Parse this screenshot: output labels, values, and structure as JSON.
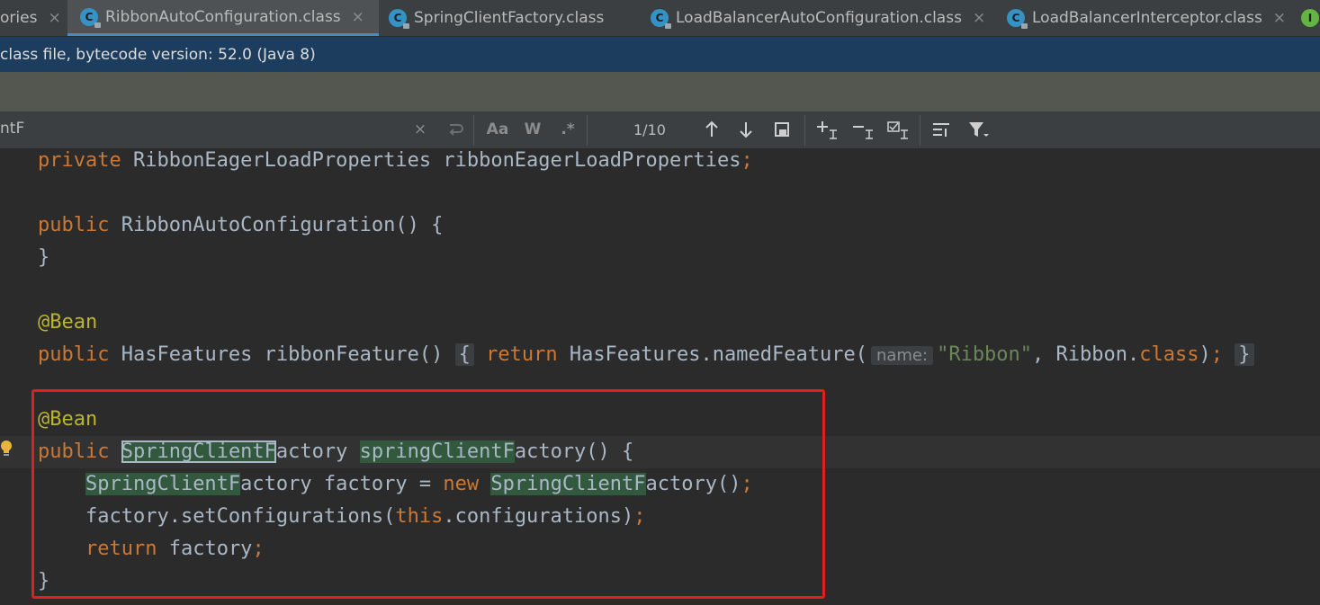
{
  "tabs": [
    {
      "label": "ories",
      "active": false,
      "closable": true
    },
    {
      "label": "RibbonAutoConfiguration.class",
      "active": true,
      "closable": true
    },
    {
      "label": "SpringClientFactory.class",
      "active": false,
      "closable": false
    },
    {
      "label": "LoadBalancerAutoConfiguration.class",
      "active": false,
      "closable": true
    },
    {
      "label": "LoadBalancerInterceptor.class",
      "active": false,
      "closable": true
    }
  ],
  "tab_icon_letter": "C",
  "interface_icon_letter": "I",
  "close_glyph": "×",
  "info_banner": "class file, bytecode version: 52.0 (Java 8)",
  "find": {
    "query": "ntF",
    "match_case": "Aa",
    "words": "W",
    "regex": ".*",
    "count": "1/10"
  },
  "code": {
    "line1": {
      "kw": "private",
      "rest": " RibbonEagerLoadProperties ribbonEagerLoadProperties",
      "semi": ";"
    },
    "line2": {
      "kw": "public",
      "rest": " RibbonAutoConfiguration() {"
    },
    "line3": "}",
    "line4": "@Bean",
    "line5": {
      "kw": "public",
      "a": " HasFeatures ribbonFeature() ",
      "fold_open": "{",
      "ret": "return",
      "b": " HasFeatures.namedFeature(",
      "hint": "name:",
      "str": "\"Ribbon\"",
      "c": ", Ribbon.",
      "cls": "class",
      "d": ")",
      "semi": ";",
      "fold_close": "}"
    },
    "line6": "@Bean",
    "line7": {
      "kw": "public",
      "m1a": "SpringClientF",
      "m1b": "actory ",
      "m2": "springClientF",
      "tail": "actory() {"
    },
    "line8": {
      "m1": "SpringClientF",
      "a": "actory factory = ",
      "new": "new",
      "m2": "SpringClientF",
      "b": "actory()",
      "semi": ";"
    },
    "line9": {
      "a": "factory.setConfigurations(",
      "this": "this",
      "b": ".configurations)",
      "semi": ";"
    },
    "line10": {
      "ret": "return",
      "a": " factory",
      "semi": ";"
    },
    "line11": "}"
  },
  "colors": {
    "accent": "#4a88c7",
    "highlight_box": "#e0201e",
    "match": "#32593d"
  }
}
